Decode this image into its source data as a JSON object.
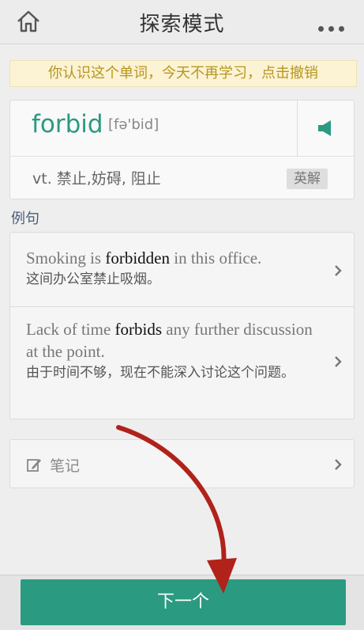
{
  "header": {
    "title": "探索模式",
    "home_icon": "home-icon",
    "more_icon": "more-icon"
  },
  "notice": {
    "text": "你认识这个单词，今天不再学习，点击撤销"
  },
  "word": {
    "text": "forbid",
    "phonetic": "[fə'bid]",
    "meaning": "vt. 禁止,妨碍, 阻止",
    "en_cn_label": "英解",
    "speaker_icon": "speaker-icon"
  },
  "examples_label": "例句",
  "examples": [
    {
      "en_before": "Smoking is ",
      "en_keyword": "forbidden",
      "en_after": " in this office.",
      "cn": "这间办公室禁止吸烟。"
    },
    {
      "en_before": "Lack of time ",
      "en_keyword": "forbids",
      "en_after": " any further discussion at the point.",
      "cn": "由于时间不够，现在不能深入讨论这个问题。"
    }
  ],
  "notes": {
    "label": "笔记",
    "icon": "edit-note-icon"
  },
  "next_button": {
    "label": "下一个"
  },
  "colors": {
    "accent": "#2a9a80",
    "notice_text": "#b8951e",
    "notice_bg": "#fbf3d3",
    "annotation_arrow": "#b0221a"
  }
}
